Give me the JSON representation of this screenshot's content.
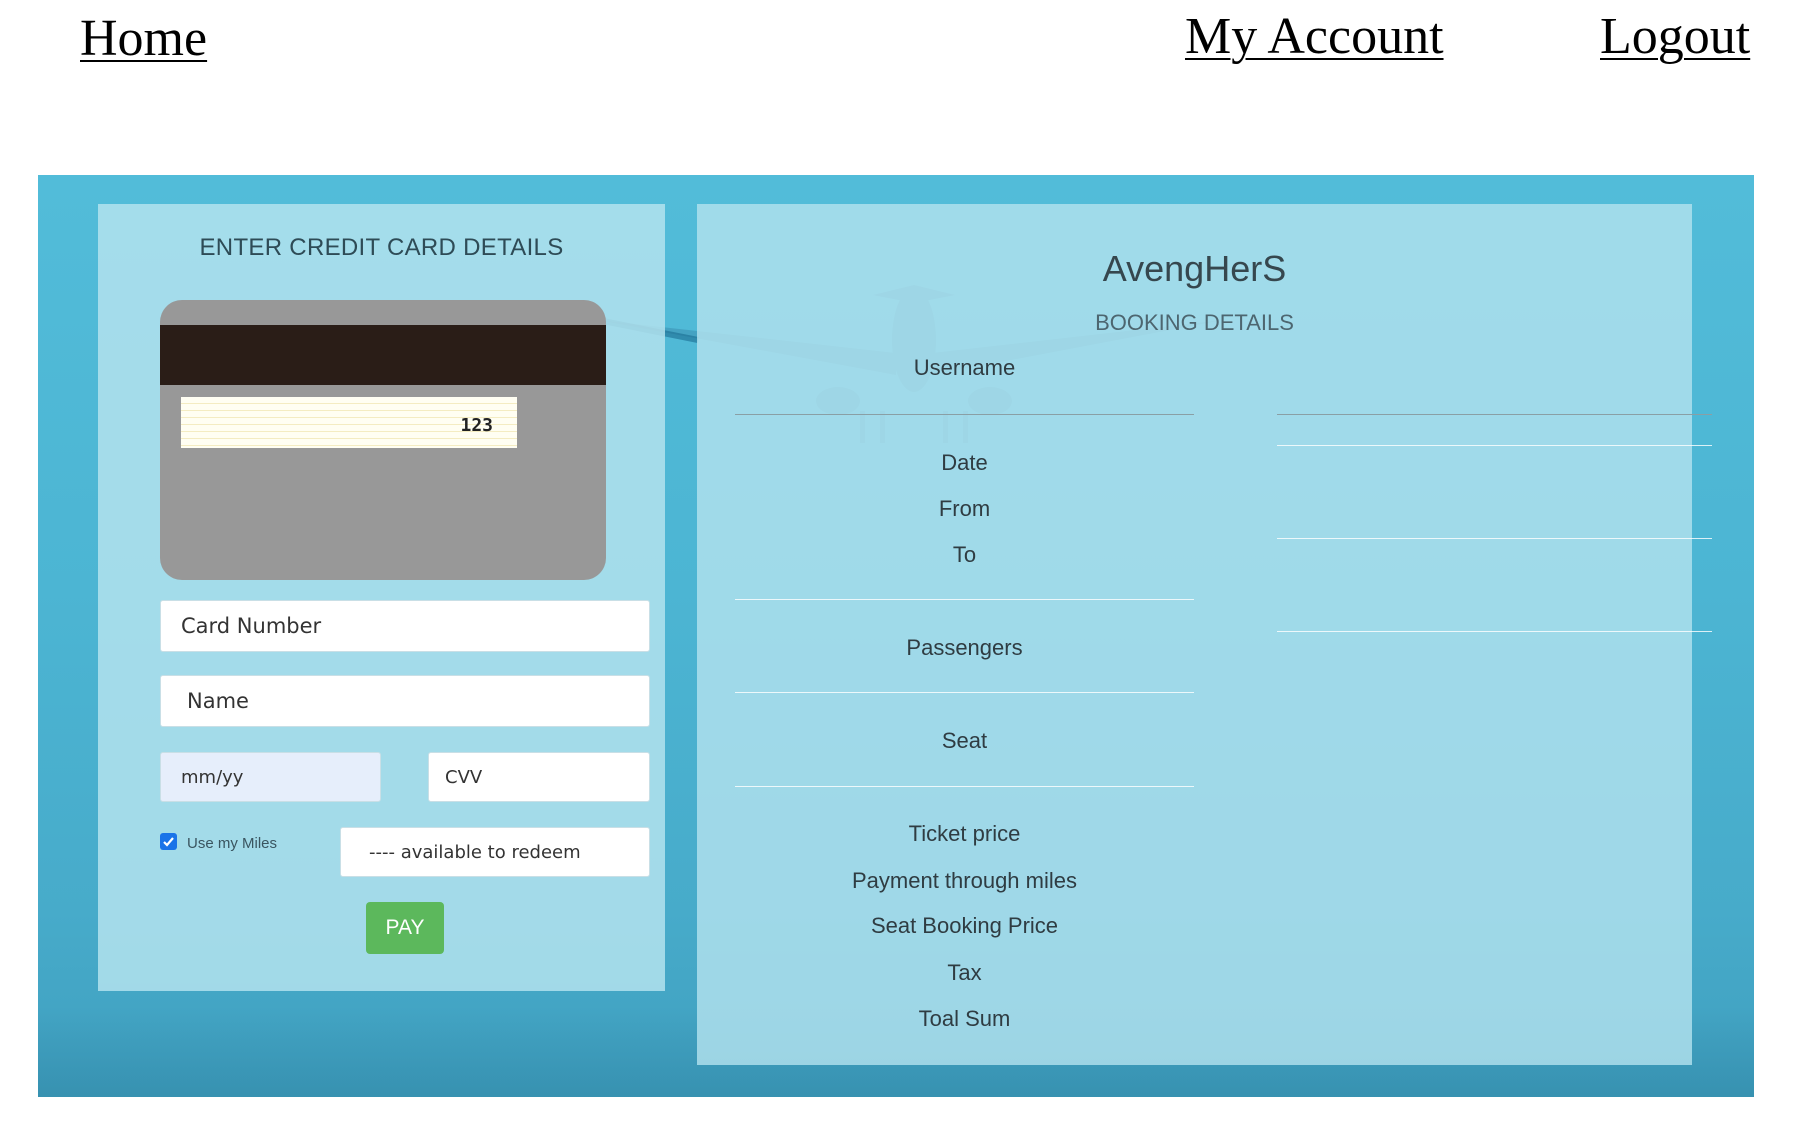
{
  "nav": {
    "home": "Home",
    "my_account": "My Account",
    "logout": "Logout"
  },
  "payment": {
    "title": "ENTER CREDIT CARD DETAILS",
    "card_preview_cvv": "123",
    "card_number_placeholder": "Card Number",
    "name_placeholder": "Name",
    "expiry_placeholder": "mm/yy",
    "cvv_placeholder": "CVV",
    "use_miles_label": "Use my Miles",
    "use_miles_checked": true,
    "miles_available_text": "---- available to redeem",
    "pay_button": "PAY"
  },
  "booking": {
    "brand": "AvengHerS",
    "subtitle": "BOOKING DETAILS",
    "labels": {
      "username": "Username",
      "date": "Date",
      "from": "From",
      "to": "To",
      "passengers": "Passengers",
      "seat": "Seat",
      "ticket_price": "Ticket price",
      "payment_through_miles": "Payment through miles",
      "seat_booking_price": "Seat Booking Price",
      "tax": "Tax",
      "total_sum": "Toal Sum"
    }
  },
  "colors": {
    "banner": "#4cb5d3",
    "panel": "#b2e2ee",
    "pay_button": "#5cb85c",
    "card_stripe": "#2a1d17",
    "card_body": "#989898",
    "checkbox": "#1a73e8"
  }
}
